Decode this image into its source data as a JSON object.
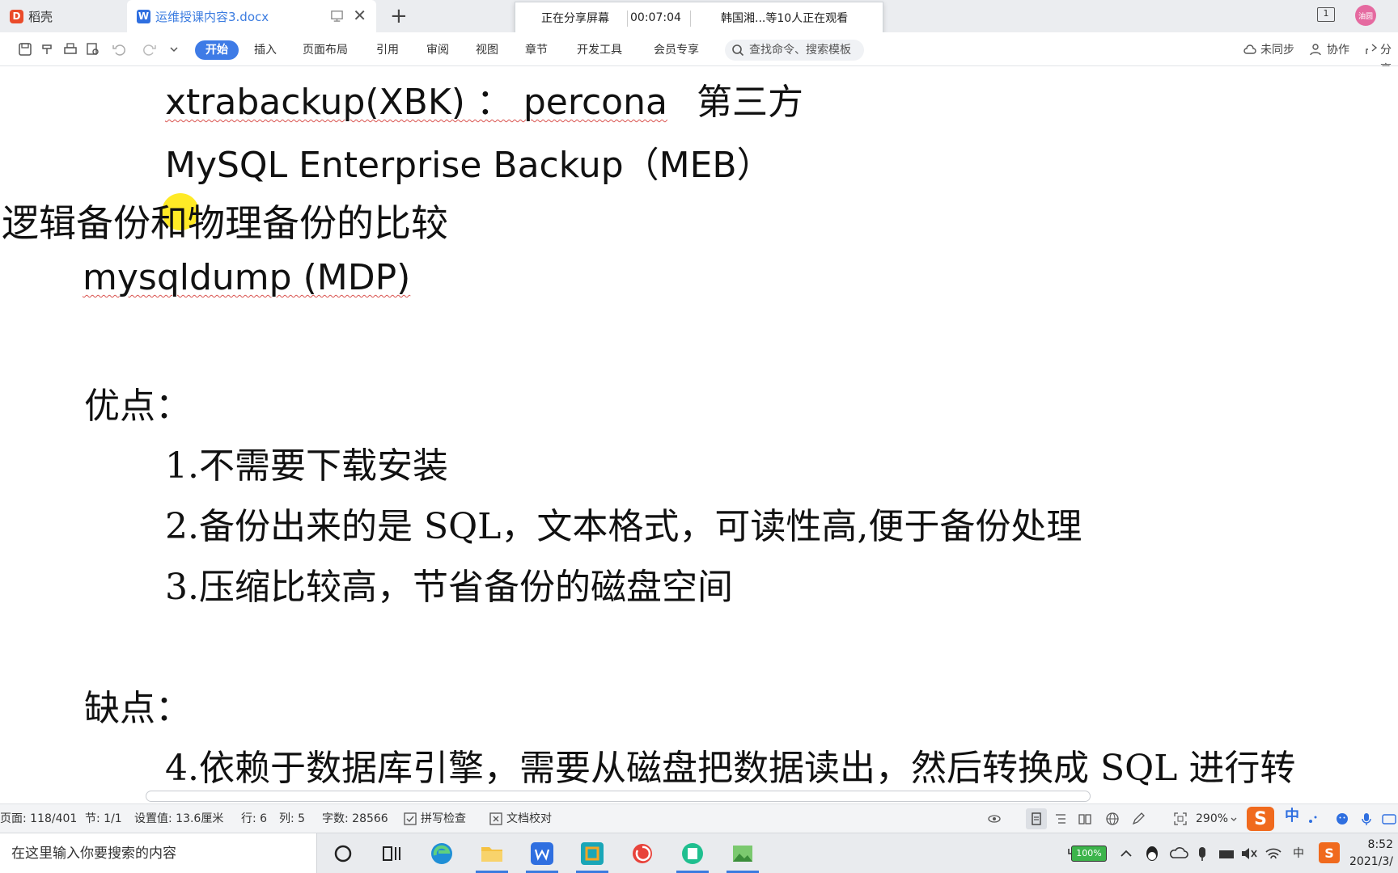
{
  "tabs": {
    "home_label": "稻壳",
    "doc_label": "运维授课内容3.docx",
    "new_tab_symbol": "+",
    "close_symbol": "✕"
  },
  "share_banner": {
    "status": "正在分享屏幕",
    "time": "00:07:04",
    "viewers": "韩国湘...等10人正在观看"
  },
  "window": {
    "page_indicator": "1",
    "avatar_text": "油圆"
  },
  "ribbon": {
    "menus": [
      "开始",
      "插入",
      "页面布局",
      "引用",
      "审阅",
      "视图",
      "章节",
      "开发工具",
      "会员专享"
    ],
    "search_placeholder": "查找命令、搜索模板",
    "sync": "未同步",
    "collab": "协作",
    "share": "分享"
  },
  "document": {
    "line1_latin": "xtrabackup(XBK) ： percona",
    "line1_cjk": "第三方",
    "line2": "MySQL Enterprise Backup（MEB）",
    "heading": "逻辑备份和物理备份的比较",
    "line3": "mysqldump (MDP)",
    "pros_title": "优点：",
    "pro1": "1.不需要下载安装",
    "pro2": "2.备份出来的是 SQL，文本格式，可读性高,便于备份处理",
    "pro3": "3.压缩比较高，节省备份的磁盘空间",
    "cons_title": "缺点：",
    "con4": "4.依赖于数据库引擎，需要从磁盘把数据读出，然后转换成 SQL 进行转"
  },
  "statusbar": {
    "page": "页面: 118/401",
    "section": "节: 1/1",
    "setting": "设置值: 13.6厘米",
    "row": "行: 6",
    "col": "列: 5",
    "wordcount": "字数: 28566",
    "spellcheck": "拼写检查",
    "proofread": "文档校对",
    "zoom": "290%",
    "ime": "中"
  },
  "taskbar": {
    "search_placeholder": "在这里输入你要搜索的内容",
    "battery": "100%",
    "ime": "中",
    "time": "8:52",
    "date": "2021/3/"
  }
}
